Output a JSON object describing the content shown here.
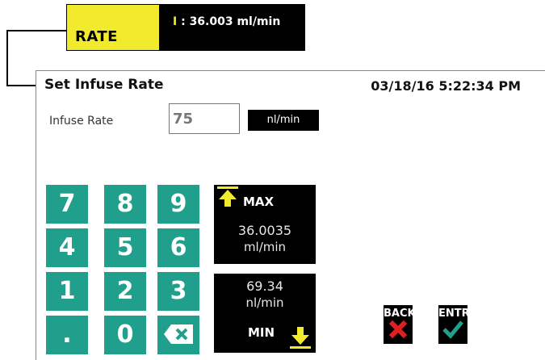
{
  "callout": {
    "tab_label": "RATE",
    "status_letter": "I",
    "status_text": ": 36.003 ml/min"
  },
  "panel": {
    "title": "Set Infuse Rate",
    "datetime": "03/18/16 5:22:34 PM"
  },
  "form": {
    "label": "Infuse Rate",
    "value": "75",
    "unit_button": "nl/min"
  },
  "keypad": {
    "keys": [
      "7",
      "8",
      "9",
      "4",
      "5",
      "6",
      "1",
      "2",
      "3",
      ".",
      "0"
    ],
    "backspace_icon": "backspace-icon"
  },
  "limits": {
    "max": {
      "label": "MAX",
      "value": "36.0035",
      "unit": "ml/min"
    },
    "min": {
      "label": "MIN",
      "value": "69.34",
      "unit": "nl/min"
    }
  },
  "actions": {
    "back_label": "BACK",
    "enter_label": "ENTR"
  },
  "colors": {
    "accent_yellow": "#f2ea2c",
    "keypad_teal": "#20a08c",
    "back_red": "#e02020",
    "enter_teal": "#20a08c"
  }
}
